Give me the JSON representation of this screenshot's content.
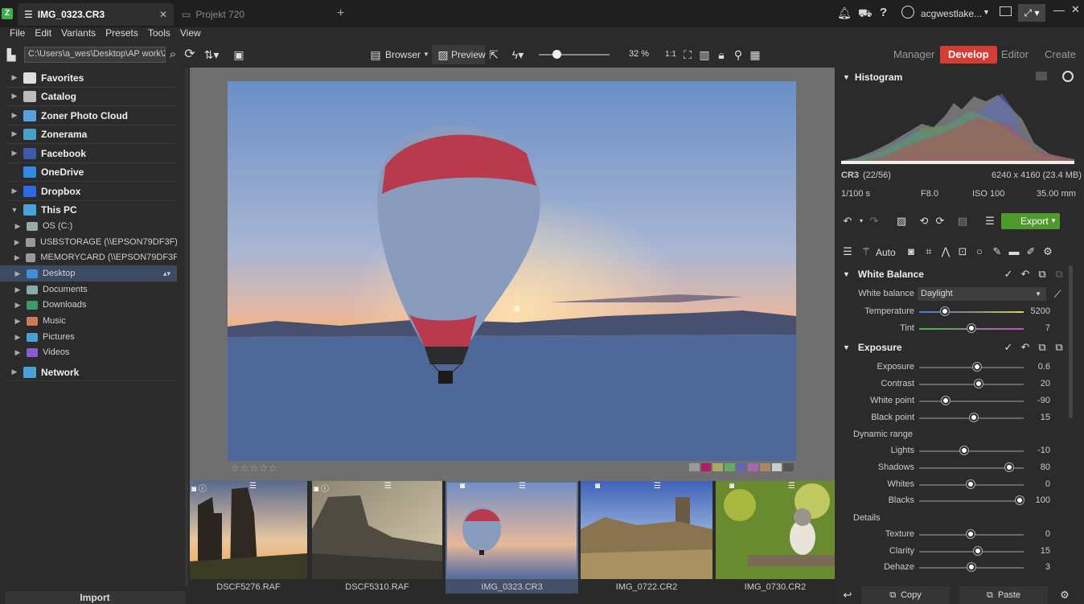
{
  "window": {
    "tabs": [
      {
        "label": "IMG_0323.CR3",
        "active": true
      },
      {
        "label": "Projekt 720",
        "active": false
      }
    ],
    "user": "acgwestlake...",
    "close_glyph": "✕",
    "add_tab_glyph": "+"
  },
  "menu": [
    "File",
    "Edit",
    "Variants",
    "Presets",
    "Tools",
    "View"
  ],
  "toolbar": {
    "path": "C:\\Users\\a_wes\\Desktop\\AP work\\ZP",
    "browser_label": "Browser",
    "preview_label": "Preview",
    "zoom": "32 %",
    "zoom_fraction": 0.25
  },
  "modes": [
    {
      "label": "Manager",
      "active": false
    },
    {
      "label": "Develop",
      "active": true
    },
    {
      "label": "Editor",
      "active": false
    },
    {
      "label": "Create",
      "active": false
    }
  ],
  "navigator": {
    "top": [
      {
        "label": "Favorites",
        "icon": "star-icon"
      },
      {
        "label": "Catalog",
        "icon": "catalog-icon"
      },
      {
        "label": "Zoner Photo Cloud",
        "icon": "cloud-icon"
      },
      {
        "label": "Zonerama",
        "icon": "zonerama-icon"
      },
      {
        "label": "Facebook",
        "icon": "facebook-icon"
      },
      {
        "label": "OneDrive",
        "icon": "onedrive-icon"
      },
      {
        "label": "Dropbox",
        "icon": "dropbox-icon"
      },
      {
        "label": "This PC",
        "icon": "pc-icon"
      }
    ],
    "pc_children": [
      {
        "label": "OS (C:)",
        "icon": "drive-icon"
      },
      {
        "label": "USBSTORAGE (\\\\EPSON79DF3F) (Y:)",
        "icon": "network-drive-icon"
      },
      {
        "label": "MEMORYCARD (\\\\EPSON79DF3F) ...",
        "icon": "network-drive-icon"
      },
      {
        "label": "Desktop",
        "icon": "desktop-icon",
        "selected": true
      },
      {
        "label": "Documents",
        "icon": "documents-icon"
      },
      {
        "label": "Downloads",
        "icon": "downloads-icon"
      },
      {
        "label": "Music",
        "icon": "music-icon"
      },
      {
        "label": "Pictures",
        "icon": "pictures-icon"
      },
      {
        "label": "Videos",
        "icon": "videos-icon"
      }
    ],
    "network": {
      "label": "Network",
      "icon": "network-icon"
    },
    "import_label": "Import"
  },
  "preview": {
    "rating_stars": "☆☆☆☆☆"
  },
  "filmstrip": [
    {
      "label": "DSCF5276.RAF",
      "scene": "ruins-sunset"
    },
    {
      "label": "DSCF5310.RAF",
      "scene": "ruins-beach"
    },
    {
      "label": "IMG_0323.CR3",
      "scene": "balloon",
      "selected": true
    },
    {
      "label": "IMG_0722.CR2",
      "scene": "castle-field"
    },
    {
      "label": "IMG_0730.CR2",
      "scene": "cat-foliage"
    }
  ],
  "histogram": {
    "title": "Histogram",
    "format": "CR3",
    "index": "(22/56)",
    "dimensions": "6240 x 4160 (23.4 MB)",
    "shutter": "1/100 s",
    "aperture": "F8.0",
    "iso": "ISO 100",
    "focal": "35.00 mm"
  },
  "actions": {
    "auto_label": "Auto",
    "export_label": "Export"
  },
  "white_balance": {
    "title": "White Balance",
    "label": "White balance",
    "preset": "Daylight",
    "sliders": [
      {
        "label": "Temperature",
        "value": "5200",
        "pos": 0.25
      },
      {
        "label": "Tint",
        "value": "7",
        "pos": 0.51
      }
    ]
  },
  "exposure": {
    "title": "Exposure",
    "sliders": [
      {
        "label": "Exposure",
        "value": "0.6",
        "pos": 0.56
      },
      {
        "label": "Contrast",
        "value": "20",
        "pos": 0.58
      },
      {
        "label": "White point",
        "value": "-90",
        "pos": 0.26
      },
      {
        "label": "Black point",
        "value": "15",
        "pos": 0.53
      }
    ],
    "dynamic_range_title": "Dynamic range",
    "dynamic_range": [
      {
        "label": "Lights",
        "value": "-10",
        "pos": 0.44
      },
      {
        "label": "Shadows",
        "value": "80",
        "pos": 0.87
      },
      {
        "label": "Whites",
        "value": "0",
        "pos": 0.5
      },
      {
        "label": "Blacks",
        "value": "100",
        "pos": 0.97
      }
    ],
    "details_title": "Details",
    "details": [
      {
        "label": "Texture",
        "value": "0",
        "pos": 0.5
      },
      {
        "label": "Clarity",
        "value": "15",
        "pos": 0.57
      },
      {
        "label": "Dehaze",
        "value": "3",
        "pos": 0.51
      }
    ]
  },
  "bottom": {
    "copy_label": "Copy",
    "paste_label": "Paste"
  }
}
